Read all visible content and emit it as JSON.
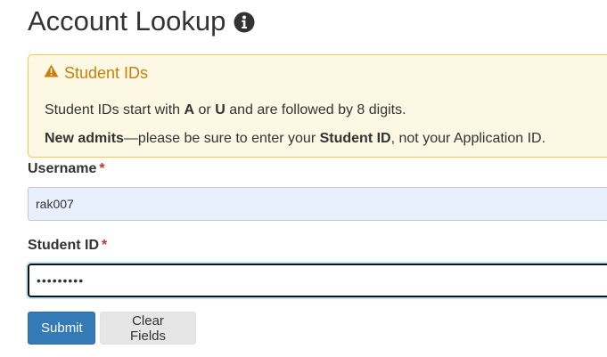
{
  "page": {
    "title": "Account Lookup"
  },
  "alert": {
    "heading": "Student IDs",
    "line1": {
      "t1": "Student IDs start with ",
      "b1": "A",
      "t2": " or ",
      "b2": "U",
      "t3": " and are followed by 8 digits."
    },
    "line2": {
      "b1": "New admits",
      "t1": "—please be sure to enter your ",
      "b2": "Student ID",
      "t2": ", not your Application ID."
    }
  },
  "form": {
    "username_label": "Username",
    "username_value": "rak007",
    "student_id_label": "Student ID",
    "student_id_value": "123456789",
    "required_marker": "*"
  },
  "buttons": {
    "submit_label": "Submit",
    "clear_label": "Clear Fields"
  },
  "icons": {
    "title_icon": "info-circle-icon",
    "alert_icon": "warning-triangle-icon"
  },
  "colors": {
    "primary": "#337ab7",
    "warning_text": "#c87f0a",
    "alert_bg": "#fcf8e3",
    "required": "#c9302c"
  }
}
